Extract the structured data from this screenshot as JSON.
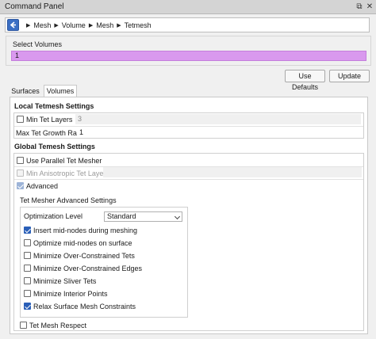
{
  "window": {
    "title": "Command Panel",
    "pin_icon": "pin-icon",
    "close_icon": "close-icon"
  },
  "breadcrumb": {
    "back_icon": "back-arrow-icon",
    "items": [
      "Mesh",
      "Volume",
      "Mesh",
      "Tetmesh"
    ]
  },
  "select_volumes": {
    "label": "Select Volumes",
    "value": "1",
    "highlight_color": "#d999ee"
  },
  "buttons": {
    "use_defaults": "Use Defaults",
    "update": "Update"
  },
  "tabs": [
    {
      "label": "Surfaces",
      "active": false
    },
    {
      "label": "Volumes",
      "active": true
    }
  ],
  "local": {
    "heading": "Local Tetmesh Settings",
    "min_tet_layers": {
      "label": "Min Tet Layers",
      "checked": false,
      "value": "3"
    },
    "max_growth": {
      "label": "Max Tet Growth Rate",
      "value": "1"
    }
  },
  "global": {
    "heading": "Global Temesh Settings",
    "use_parallel": {
      "label": "Use Parallel Tet Mesher",
      "checked": false
    },
    "min_aniso": {
      "label": "Min Anisotropic Tet Layers",
      "checked": false,
      "disabled": true
    },
    "advanced": {
      "label": "Advanced",
      "checked": true,
      "disabled": true
    }
  },
  "advanced_settings": {
    "heading": "Tet Mesher Advanced Settings",
    "optimization_level": {
      "label": "Optimization Level",
      "value": "Standard"
    },
    "options": [
      {
        "label": "Insert mid-nodes during meshing",
        "checked": true
      },
      {
        "label": "Optimize mid-nodes on surface",
        "checked": false
      },
      {
        "label": "Minimize Over-Constrained Tets",
        "checked": false
      },
      {
        "label": "Minimize Over-Constrained Edges",
        "checked": false
      },
      {
        "label": "Minimize Sliver Tets",
        "checked": false
      },
      {
        "label": "Minimize Interior Points",
        "checked": false
      },
      {
        "label": "Relax Surface Mesh Constraints",
        "checked": true
      }
    ]
  },
  "tet_mesh_respect": {
    "label": "Tet Mesh Respect",
    "checked": false
  },
  "colors": {
    "accent": "#2a5fb8",
    "back_button": "#3b6fc4"
  }
}
